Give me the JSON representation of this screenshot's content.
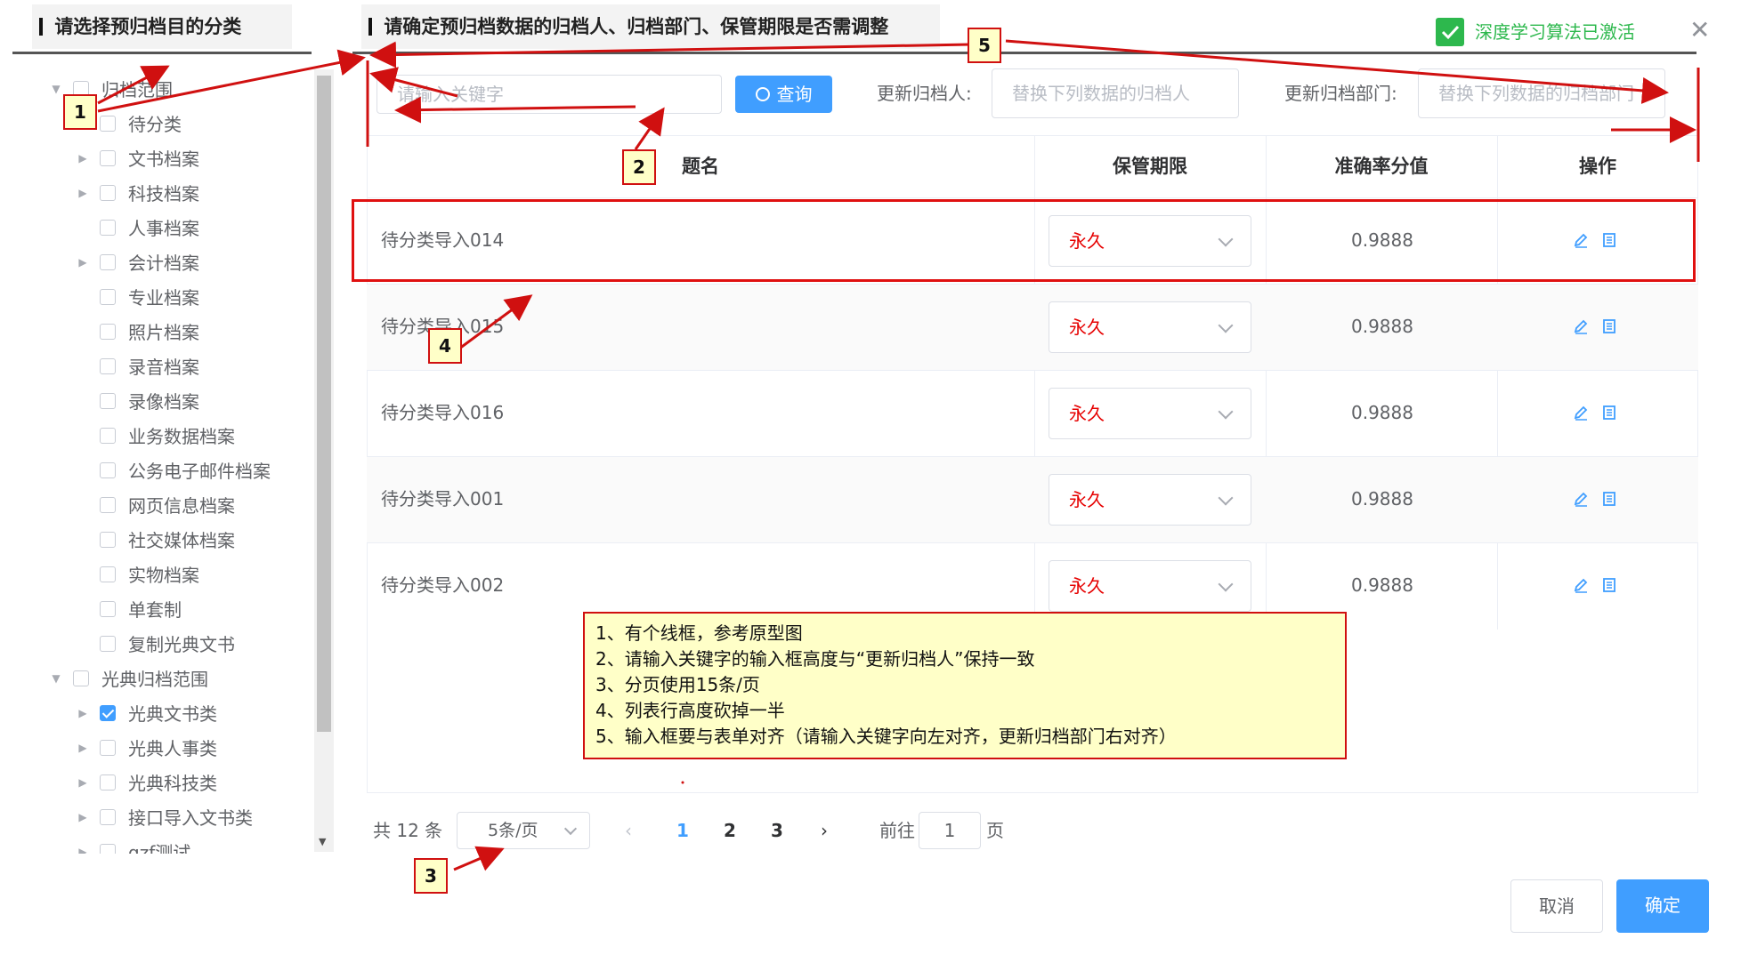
{
  "left_panel": {
    "title": "请选择预归档目的分类",
    "tree": [
      {
        "label": "归档范围",
        "level": 0,
        "expanded": true,
        "checked": false
      },
      {
        "label": "待分类",
        "level": 1,
        "expandable": false,
        "checked": false
      },
      {
        "label": "文书档案",
        "level": 1,
        "expandable": true,
        "checked": false
      },
      {
        "label": "科技档案",
        "level": 1,
        "expandable": true,
        "checked": false
      },
      {
        "label": "人事档案",
        "level": 1,
        "expandable": false,
        "checked": false
      },
      {
        "label": "会计档案",
        "level": 1,
        "expandable": true,
        "checked": false
      },
      {
        "label": "专业档案",
        "level": 1,
        "expandable": false,
        "checked": false
      },
      {
        "label": "照片档案",
        "level": 1,
        "expandable": false,
        "checked": false
      },
      {
        "label": "录音档案",
        "level": 1,
        "expandable": false,
        "checked": false
      },
      {
        "label": "录像档案",
        "level": 1,
        "expandable": false,
        "checked": false
      },
      {
        "label": "业务数据档案",
        "level": 1,
        "expandable": false,
        "checked": false
      },
      {
        "label": "公务电子邮件档案",
        "level": 1,
        "expandable": false,
        "checked": false
      },
      {
        "label": "网页信息档案",
        "level": 1,
        "expandable": false,
        "checked": false
      },
      {
        "label": "社交媒体档案",
        "level": 1,
        "expandable": false,
        "checked": false
      },
      {
        "label": "实物档案",
        "level": 1,
        "expandable": false,
        "checked": false
      },
      {
        "label": "单套制",
        "level": 1,
        "expandable": false,
        "checked": false
      },
      {
        "label": "复制光典文书",
        "level": 1,
        "expandable": false,
        "checked": false
      },
      {
        "label": "光典归档范围",
        "level": 0,
        "expanded": true,
        "checked": false
      },
      {
        "label": "光典文书类",
        "level": 1,
        "expandable": true,
        "checked": true
      },
      {
        "label": "光典人事类",
        "level": 1,
        "expandable": true,
        "checked": false
      },
      {
        "label": "光典科技类",
        "level": 1,
        "expandable": true,
        "checked": false
      },
      {
        "label": "接口导入文书类",
        "level": 1,
        "expandable": true,
        "checked": false
      },
      {
        "label": "gzf测试",
        "level": 1,
        "expandable": true,
        "checked": false
      }
    ]
  },
  "right_panel": {
    "title": "请确定预归档数据的归档人、归档部门、保管期限是否需调整",
    "status_text": "深度学习算法已激活",
    "search": {
      "placeholder": "请输入关键字",
      "button_label": "查询"
    },
    "update_person": {
      "label": "更新归档人:",
      "placeholder": "替换下列数据的归档人"
    },
    "update_dept": {
      "label": "更新归档部门:",
      "placeholder": "替换下列数据的归档部门"
    },
    "table": {
      "columns": [
        "题名",
        "保管期限",
        "准确率分值",
        "操作"
      ],
      "rows": [
        {
          "title": "待分类导入014",
          "retention": "永久",
          "score": "0.9888"
        },
        {
          "title": "待分类导入015",
          "retention": "永久",
          "score": "0.9888"
        },
        {
          "title": "待分类导入016",
          "retention": "永久",
          "score": "0.9888"
        },
        {
          "title": "待分类导入001",
          "retention": "永久",
          "score": "0.9888"
        },
        {
          "title": "待分类导入002",
          "retention": "永久",
          "score": "0.9888"
        }
      ]
    },
    "pagination": {
      "total_text": "共 12 条",
      "page_size": "5条/页",
      "pages": [
        "1",
        "2",
        "3"
      ],
      "current_page": "1",
      "goto_label": "前往",
      "goto_value": "1",
      "page_suffix": "页"
    }
  },
  "footer": {
    "cancel_label": "取消",
    "confirm_label": "确定"
  },
  "annotations": {
    "tags": [
      "1",
      "2",
      "3",
      "4",
      "5"
    ],
    "note_lines": [
      "1、有个线框，参考原型图",
      "2、请输入关键字的输入框高度与“更新归档人”保持一致",
      "3、分页使用15条/页",
      "4、列表行高度砍掉一半",
      "5、输入框要与表单对齐（请输入关键字向左对齐，更新归档部门右对齐）"
    ]
  },
  "colors": {
    "accent": "#409eff",
    "retention": "#e60000",
    "annotation_red": "#d01010",
    "status_green": "#2db84d"
  }
}
